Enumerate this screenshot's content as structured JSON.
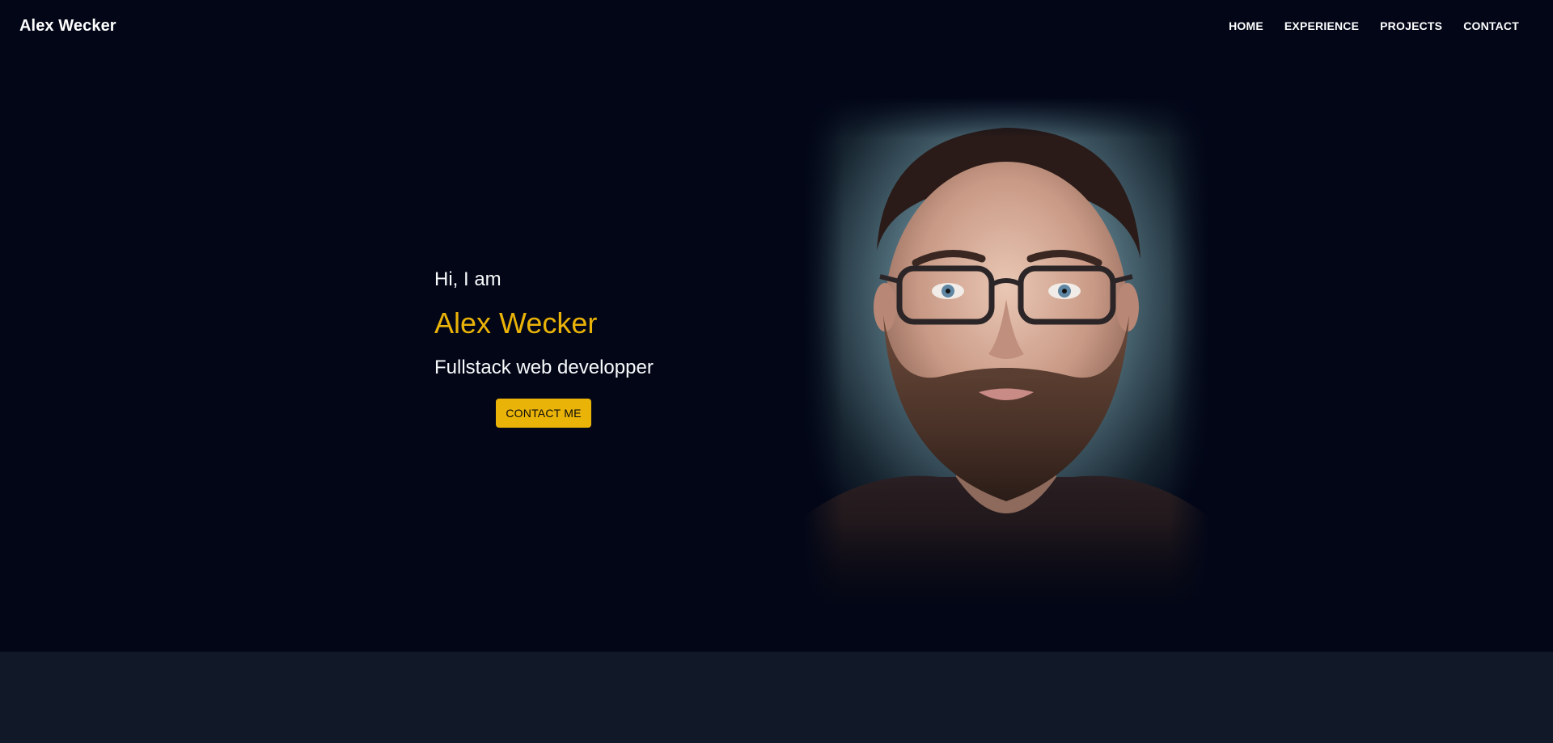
{
  "header": {
    "brand": "Alex Wecker",
    "nav": [
      {
        "label": "HOME"
      },
      {
        "label": "EXPERIENCE"
      },
      {
        "label": "PROJECTS"
      },
      {
        "label": "CONTACT"
      }
    ]
  },
  "hero": {
    "greeting": "Hi, I am",
    "name": "Alex Wecker",
    "role": "Fullstack web developper",
    "cta_label": "CONTACT ME",
    "portrait_icon": "portrait-photo"
  },
  "colors": {
    "background": "#020617",
    "accent": "#eab308",
    "section_alt": "#111827",
    "text": "#f8fafc"
  }
}
